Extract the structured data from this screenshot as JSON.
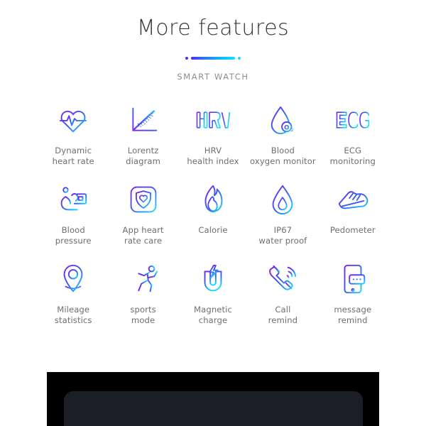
{
  "header": {
    "title": "More features",
    "subtitle": "SMART WATCH",
    "divider": {
      "left_dot_color": "#4a2ff0",
      "bar_gradient_start": "#4a2ff0",
      "bar_gradient_end": "#16e0ff",
      "right_dot_color": "#17ddff"
    }
  },
  "theme": {
    "background": "#ffffff",
    "title_color": "#383838",
    "subtitle_color": "#8d8d8d",
    "label_color": "#6f6f6f",
    "icon_gradient_start": "#7a22f0",
    "icon_gradient_mid": "#3a5cf5",
    "icon_gradient_end": "#18dcff",
    "device_band_color": "#000000",
    "device_screen_color": "#1b1e22"
  },
  "features": [
    {
      "icon": "heart-pulse-icon",
      "label": "Dynamic\nheart rate"
    },
    {
      "icon": "lorentz-scatter-icon",
      "label": "Lorentz\ndiagram"
    },
    {
      "icon": "hrv-text-icon",
      "label": "HRV\nhealth index"
    },
    {
      "icon": "blood-oxygen-drop-icon",
      "label": "Blood\noxygen monitor"
    },
    {
      "icon": "ecg-text-icon",
      "label": "ECG\nmonitoring"
    },
    {
      "icon": "blood-pressure-cuff-icon",
      "label": "Blood\npressure"
    },
    {
      "icon": "app-shield-heart-icon",
      "label": "App heart\nrate care"
    },
    {
      "icon": "flame-icon",
      "label": "Calorie"
    },
    {
      "icon": "water-drop-icon",
      "label": "IP67\nwater proof"
    },
    {
      "icon": "running-shoe-icon",
      "label": "Pedometer"
    },
    {
      "icon": "map-pin-icon",
      "label": "Mileage\nstatistics"
    },
    {
      "icon": "running-person-icon",
      "label": "sports\nmode"
    },
    {
      "icon": "magnet-bolt-icon",
      "label": "Magnetic\ncharge"
    },
    {
      "icon": "phone-ring-icon",
      "label": "Call\nremind"
    },
    {
      "icon": "phone-message-icon",
      "label": "message\nremind"
    }
  ]
}
